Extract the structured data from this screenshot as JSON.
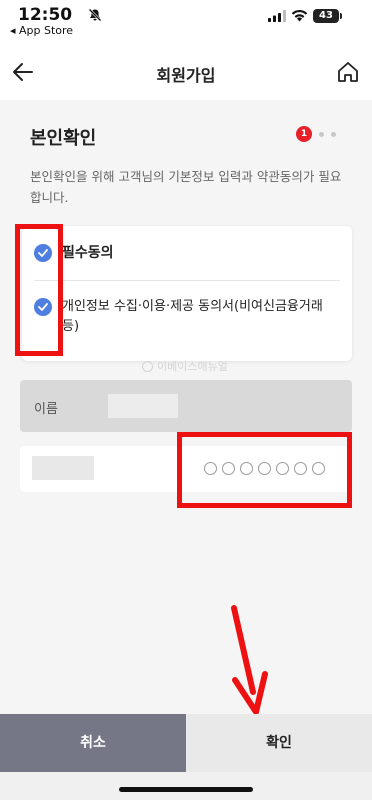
{
  "status_bar": {
    "time": "12:50",
    "back_app": "◂ App Store",
    "battery": "43",
    "icons": [
      "bell-slash-icon",
      "signal-icon",
      "wifi-icon",
      "battery-icon"
    ]
  },
  "nav": {
    "title": "회원가입",
    "icons": [
      "back-arrow-icon",
      "home-icon"
    ]
  },
  "section": {
    "title": "본인확인",
    "step_current": "1"
  },
  "description": "본인확인을 위해 고객님의 기본정보 입력과 약관동의가 필요합니다.",
  "agreements": {
    "all_label": "필수동의",
    "item_label": "개인정보 수집·이용·제공 동의서(비여신금융거래 등)",
    "all_checked": true,
    "item_checked": true
  },
  "watermark": "이베이스매뉴얼",
  "form": {
    "name_label": "이름"
  },
  "buttons": {
    "cancel": "취소",
    "confirm": "확인"
  },
  "colors": {
    "check": "#4d7ee0",
    "step_active": "#e8202a",
    "cancel_bg": "#757786",
    "highlight": "#ee1111"
  }
}
